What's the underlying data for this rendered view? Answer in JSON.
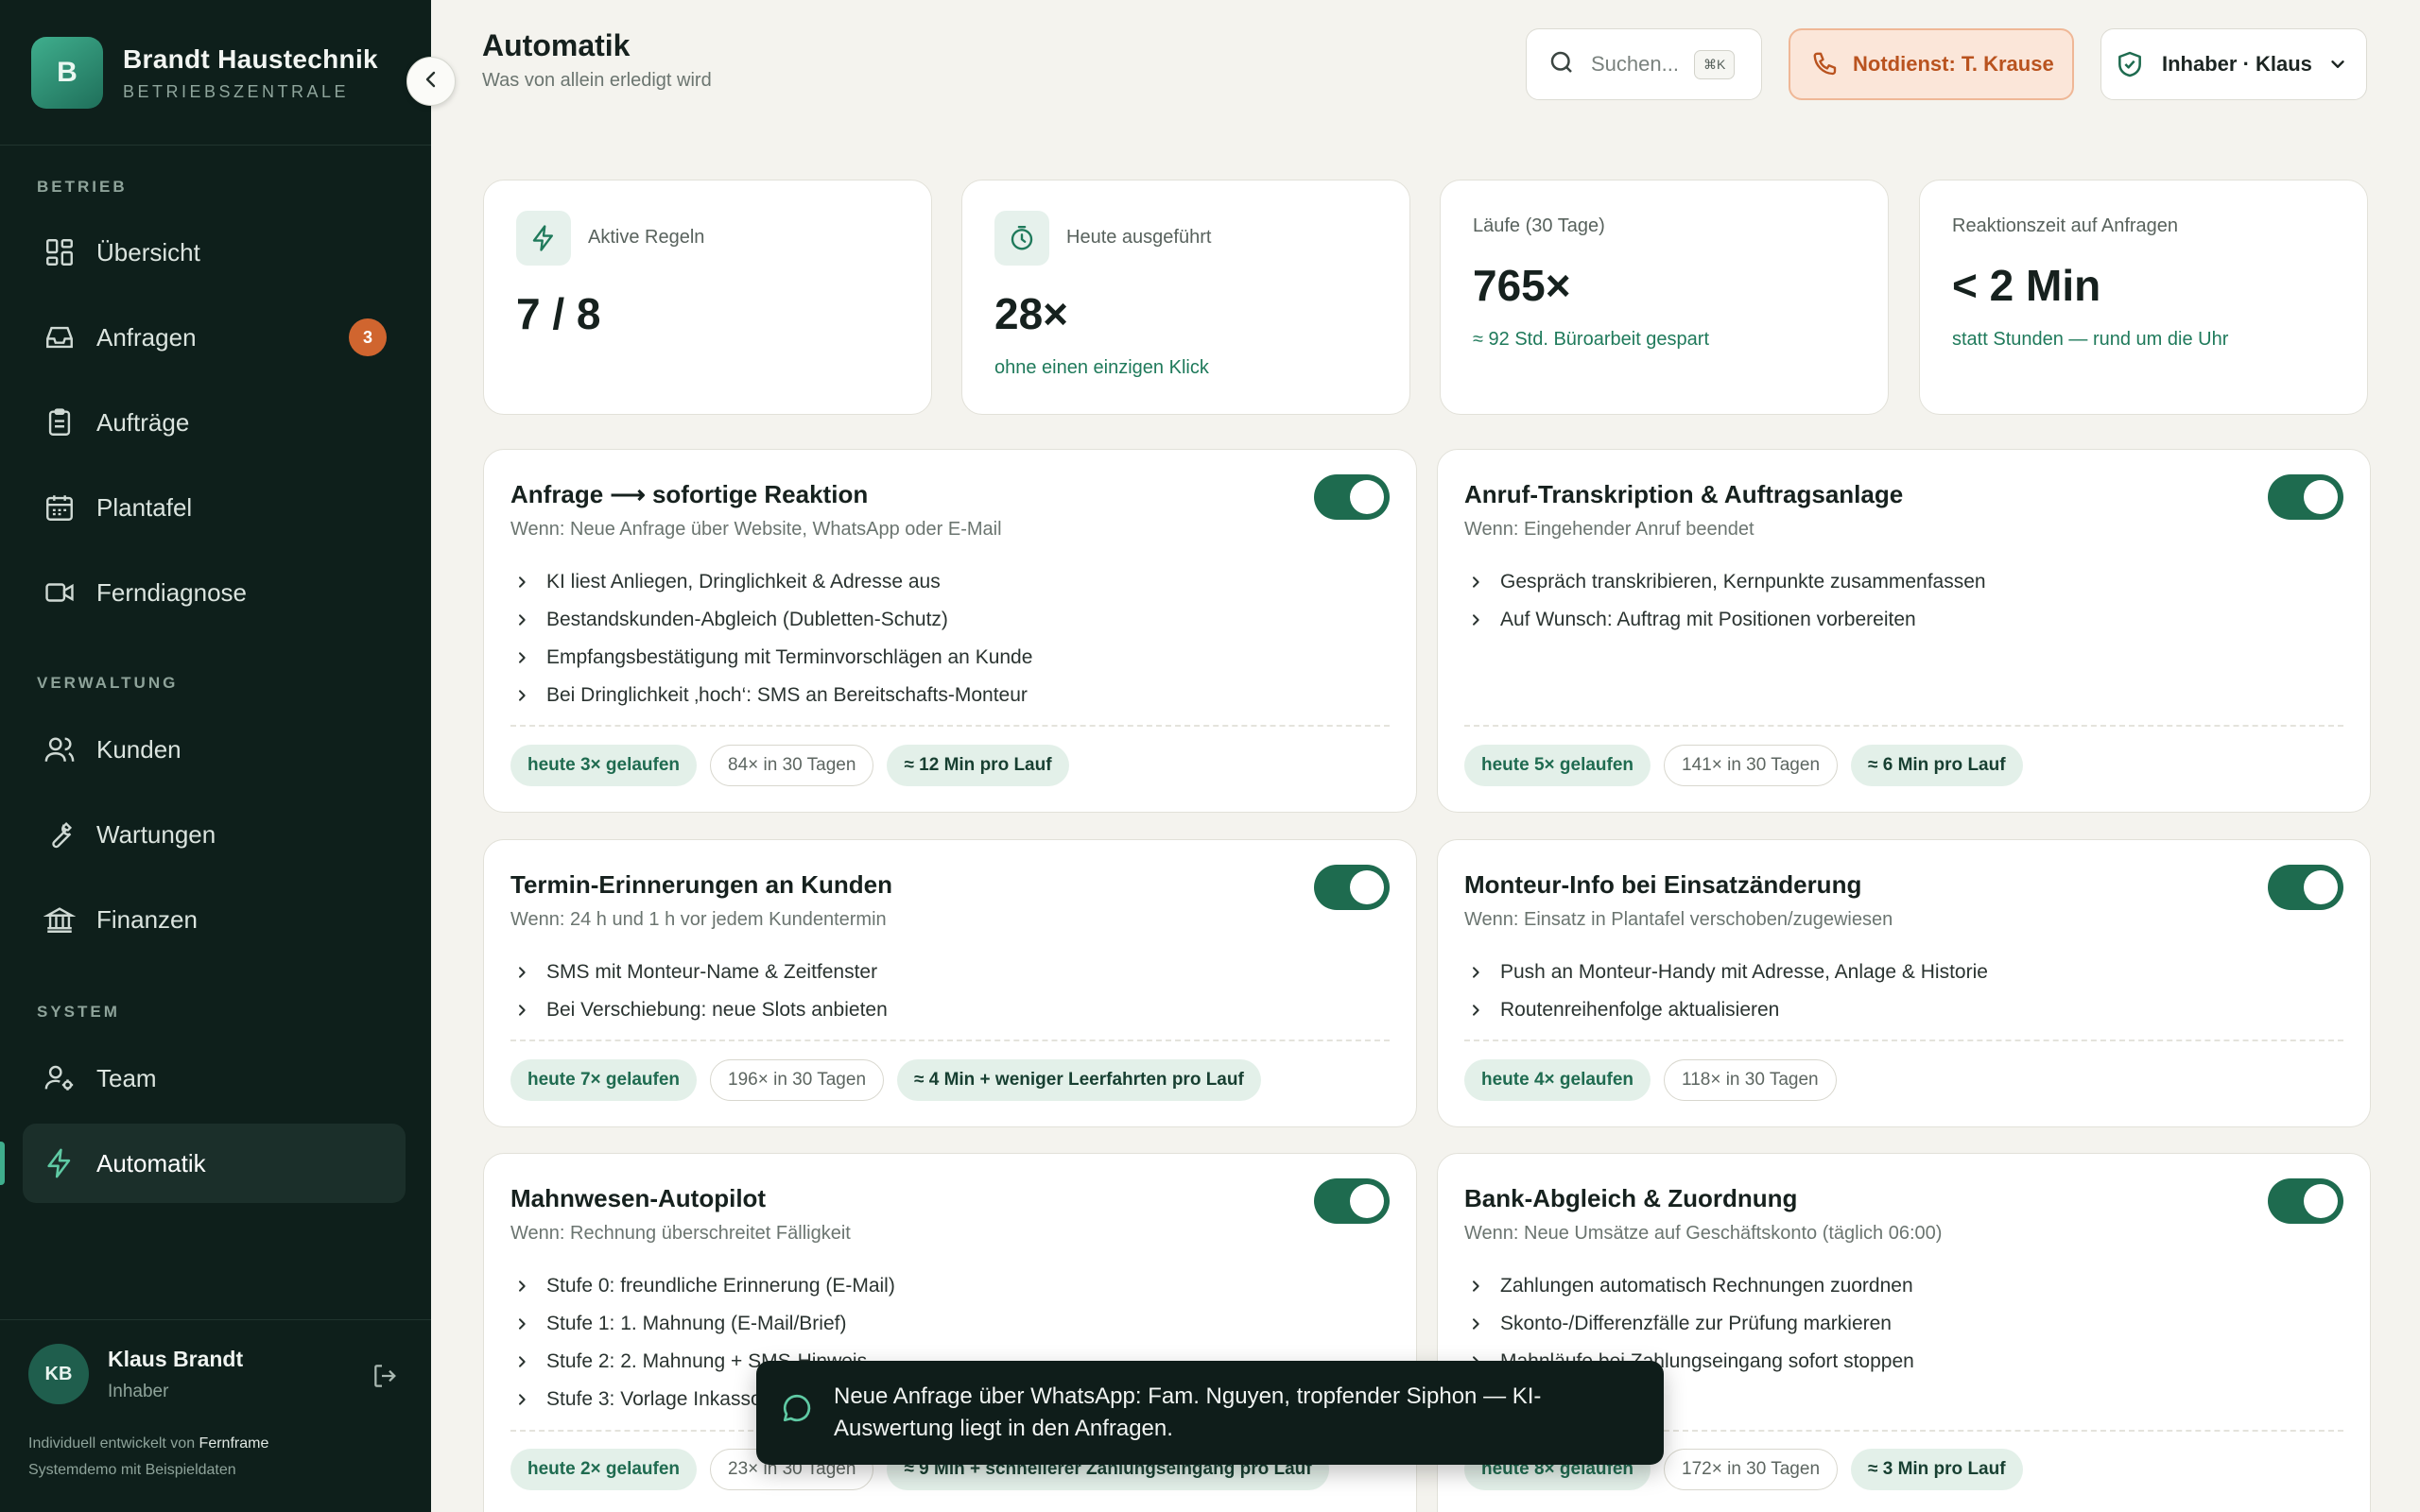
{
  "brand": {
    "initial": "B",
    "name": "Brandt Haustechnik",
    "sub": "BETRIEBSZENTRALE"
  },
  "sidebar": {
    "sections": [
      {
        "label": "BETRIEB"
      },
      {
        "label": "VERWALTUNG"
      },
      {
        "label": "SYSTEM"
      }
    ],
    "items": [
      {
        "label": "Übersicht",
        "icon": "grid-icon"
      },
      {
        "label": "Anfragen",
        "icon": "inbox-icon",
        "badge": "3"
      },
      {
        "label": "Aufträge",
        "icon": "clipboard-icon"
      },
      {
        "label": "Plantafel",
        "icon": "calendar-icon"
      },
      {
        "label": "Ferndiagnose",
        "icon": "video-icon"
      },
      {
        "label": "Kunden",
        "icon": "users-icon"
      },
      {
        "label": "Wartungen",
        "icon": "wrench-icon"
      },
      {
        "label": "Finanzen",
        "icon": "bank-icon"
      },
      {
        "label": "Team",
        "icon": "user-cog-icon"
      },
      {
        "label": "Automatik",
        "icon": "bolt-icon",
        "active": true
      }
    ]
  },
  "user": {
    "initials": "KB",
    "name": "Klaus Brandt",
    "role": "Inhaber"
  },
  "credit": {
    "prefix": "Individuell entwickelt von ",
    "link": "Fernframe",
    "demo": "Systemdemo mit Beispieldaten"
  },
  "header": {
    "title": "Automatik",
    "subtitle": "Was von allein erledigt wird",
    "search_placeholder": "Suchen...",
    "search_kbd": "⌘K",
    "notdienst": "Notdienst: T. Krause",
    "owner": "Inhaber · Klaus"
  },
  "stats": [
    {
      "label": "Aktive Regeln",
      "value": "7 / 8",
      "note": "",
      "icon": "bolt-icon"
    },
    {
      "label": "Heute ausgeführt",
      "value": "28×",
      "note": "ohne einen einzigen Klick",
      "icon": "timer-icon"
    },
    {
      "label": "Läufe (30 Tage)",
      "value": "765×",
      "note": "≈ 92 Std. Büroarbeit gespart"
    },
    {
      "label": "Reaktionszeit auf Anfragen",
      "value": "< 2 Min",
      "note": "statt Stunden — rund um die Uhr"
    }
  ],
  "rules": [
    {
      "title": "Anfrage ⟶ sofortige Reaktion",
      "condition": "Wenn: Neue Anfrage über Website, WhatsApp oder E-Mail",
      "enabled": true,
      "steps": [
        "KI liest Anliegen, Dringlichkeit & Adresse aus",
        "Bestandskunden-Abgleich (Dubletten-Schutz)",
        "Empfangsbestätigung mit Terminvorschlägen an Kunde",
        "Bei Dringlichkeit ‚hoch‘: SMS an Bereitschafts-Monteur"
      ],
      "today": "heute 3× gelaufen",
      "month": "84× in 30 Tagen",
      "saving": "≈ 12 Min pro Lauf"
    },
    {
      "title": "Anruf-Transkription & Auftragsanlage",
      "condition": "Wenn: Eingehender Anruf beendet",
      "enabled": true,
      "steps": [
        "Gespräch transkribieren, Kernpunkte zusammenfassen",
        "Auf Wunsch: Auftrag mit Positionen vorbereiten"
      ],
      "today": "heute 5× gelaufen",
      "month": "141× in 30 Tagen",
      "saving": "≈ 6 Min pro Lauf"
    },
    {
      "title": "Termin-Erinnerungen an Kunden",
      "condition": "Wenn: 24 h und 1 h vor jedem Kundentermin",
      "enabled": true,
      "steps": [
        "SMS mit Monteur-Name & Zeitfenster",
        "Bei Verschiebung: neue Slots anbieten"
      ],
      "today": "heute 7× gelaufen",
      "month": "196× in 30 Tagen",
      "saving": "≈ 4 Min + weniger Leerfahrten pro Lauf"
    },
    {
      "title": "Monteur-Info bei Einsatzänderung",
      "condition": "Wenn: Einsatz in Plantafel verschoben/zugewiesen",
      "enabled": true,
      "steps": [
        "Push an Monteur-Handy mit Adresse, Anlage & Historie",
        "Routenreihenfolge aktualisieren"
      ],
      "today": "heute 4× gelaufen",
      "month": "118× in 30 Tagen",
      "saving": ""
    },
    {
      "title": "Mahnwesen-Autopilot",
      "condition": "Wenn: Rechnung überschreitet Fälligkeit",
      "enabled": true,
      "steps": [
        "Stufe 0: freundliche Erinnerung (E-Mail)",
        "Stufe 1: 1. Mahnung (E-Mail/Brief)",
        "Stufe 2: 2. Mahnung + SMS-Hinweis",
        "Stufe 3: Vorlage Inkasso"
      ],
      "today": "heute 2× gelaufen",
      "month": "23× in 30 Tagen",
      "saving": "≈ 9 Min + schnellerer Zahlungseingang pro Lauf"
    },
    {
      "title": "Bank-Abgleich & Zuordnung",
      "condition": "Wenn: Neue Umsätze auf Geschäftskonto (täglich 06:00)",
      "enabled": true,
      "steps": [
        "Zahlungen automatisch Rechnungen zuordnen",
        "Skonto-/Differenzfälle zur Prüfung markieren",
        "Mahnläufe bei Zahlungseingang sofort stoppen"
      ],
      "today": "heute 8× gelaufen",
      "month": "172× in 30 Tagen",
      "saving": "≈ 3 Min pro Lauf"
    }
  ],
  "toast": {
    "icon": "chat-bubble-icon",
    "message": "Neue Anfrage über WhatsApp: Fam. Nguyen, tropfender Siphon — KI-Auswertung liegt in den Anfragen."
  }
}
